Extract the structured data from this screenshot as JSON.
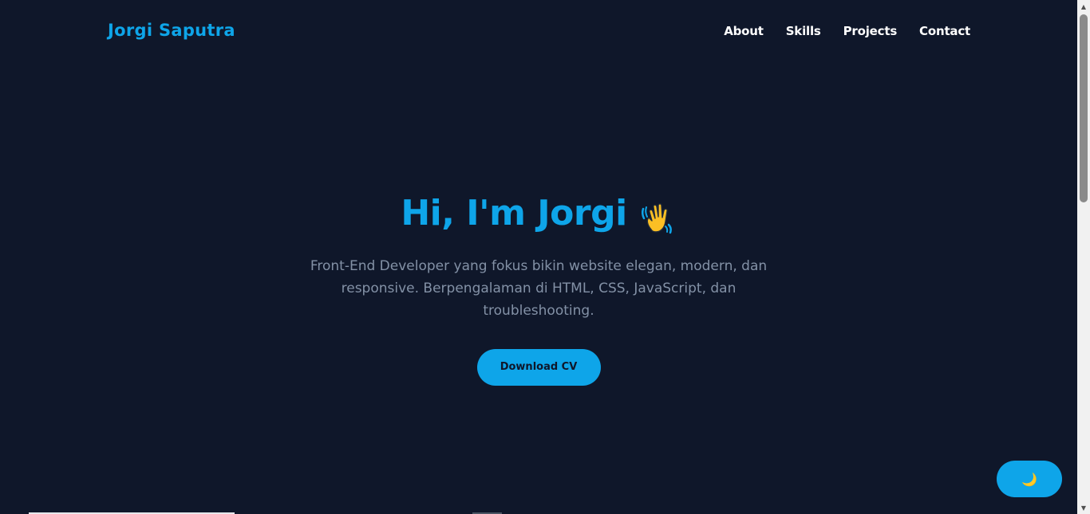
{
  "brand": {
    "name": "Jorgi Saputra",
    "accent_color": "#0ea5e9",
    "background_color": "#0f172a"
  },
  "nav": {
    "items": [
      {
        "label": "About"
      },
      {
        "label": "Skills"
      },
      {
        "label": "Projects"
      },
      {
        "label": "Contact"
      }
    ]
  },
  "hero": {
    "title": "Hi, I'm Jorgi",
    "title_icon": "waving-hand-icon",
    "description": "Front-End Developer yang fokus bikin website elegan, modern, dan responsive. Berpengalaman di HTML, CSS, JavaScript, dan troubleshooting.",
    "cta_label": "Download CV"
  },
  "theme_toggle": {
    "icon": "moon-icon",
    "glyph": "🌙"
  }
}
